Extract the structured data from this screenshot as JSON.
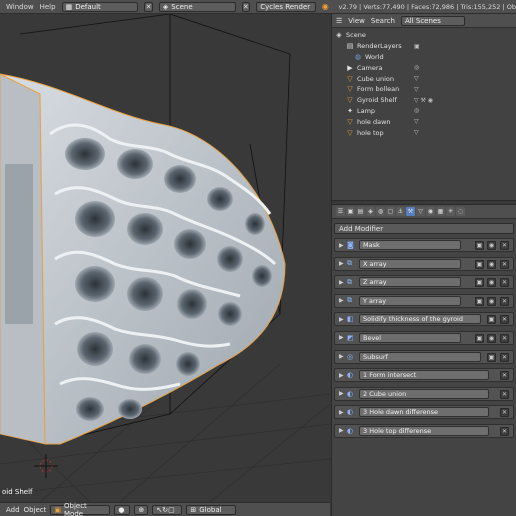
{
  "topbar": {
    "menus": [
      "Window",
      "Help"
    ],
    "screen_layout": "Default",
    "scene": "Scene",
    "render_engine": "Cycles Render",
    "stats": "v2.79 | Verts:77,490 | Faces:72,986 | Tris:155,252 | Ob"
  },
  "outliner": {
    "menus": [
      "View",
      "Search"
    ],
    "filter": "All Scenes",
    "items": [
      {
        "label": "Scene",
        "icon": "scene-icon"
      },
      {
        "label": "RenderLayers",
        "icon": "renderlayers-icon"
      },
      {
        "label": "World",
        "icon": "world-icon"
      },
      {
        "label": "Camera",
        "icon": "camera-icon"
      },
      {
        "label": "Cube union",
        "icon": "mesh-icon"
      },
      {
        "label": "Form bollean",
        "icon": "mesh-icon"
      },
      {
        "label": "Gyroid Shelf",
        "icon": "mesh-icon"
      },
      {
        "label": "Lamp",
        "icon": "lamp-icon"
      },
      {
        "label": "hole dawn",
        "icon": "mesh-icon"
      },
      {
        "label": "hole top",
        "icon": "mesh-icon"
      }
    ]
  },
  "properties": {
    "add_modifier": "Add Modifier",
    "modifiers": [
      {
        "name": "Mask"
      },
      {
        "name": "X array"
      },
      {
        "name": "Z array"
      },
      {
        "name": "Y array"
      },
      {
        "name": "Solidify thickness of the gyroid"
      },
      {
        "name": "Bevel"
      },
      {
        "name": "Subsurf"
      },
      {
        "name": "1 Form intersect"
      },
      {
        "name": "2 Cube union"
      },
      {
        "name": "3 Hole dawn differense"
      },
      {
        "name": "3 Hole top differense"
      }
    ]
  },
  "viewport": {
    "object_label": "oid Shelf"
  },
  "bottombar": {
    "menus": [
      "Add",
      "Object"
    ],
    "mode": "Object Mode",
    "orientation": "Global"
  },
  "colors": {
    "accent": "#5680c2",
    "selection_outline": "#e8a040",
    "background": "#393939"
  }
}
